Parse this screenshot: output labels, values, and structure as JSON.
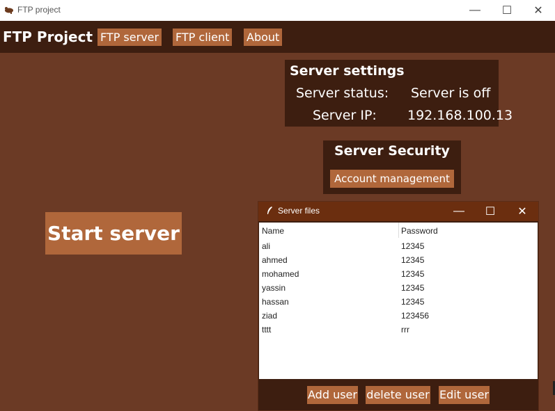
{
  "window": {
    "title": "FTP project",
    "controls": {
      "minimize": "—",
      "maximize": "☐",
      "close": "✕"
    }
  },
  "navbar": {
    "brand": "FTP Project",
    "items": [
      "FTP server",
      "FTP client",
      "About"
    ]
  },
  "server_settings": {
    "title": "Server settings",
    "status_label": "Server status:",
    "status_value": "Server is off",
    "ip_label": "Server IP:",
    "ip_value": "192.168.100.13"
  },
  "server_security": {
    "title": "Server Security",
    "account_button": "Account management"
  },
  "start_button": "Start server",
  "server_files": {
    "title": "Server files",
    "columns": [
      "Name",
      "Password"
    ],
    "rows": [
      [
        "ali",
        "12345"
      ],
      [
        "ahmed",
        "12345"
      ],
      [
        "mohamed",
        "12345"
      ],
      [
        "yassin",
        "12345"
      ],
      [
        "hassan",
        "12345"
      ],
      [
        "ziad",
        "123456"
      ],
      [
        "tttt",
        "rrr"
      ]
    ],
    "buttons": {
      "add": "Add user",
      "delete": "delete user",
      "edit": "Edit user"
    }
  },
  "colors": {
    "background": "#6b3a25",
    "panel": "#3d1e10",
    "button": "#b0673b",
    "child_titlebar": "#6b2e0f"
  }
}
